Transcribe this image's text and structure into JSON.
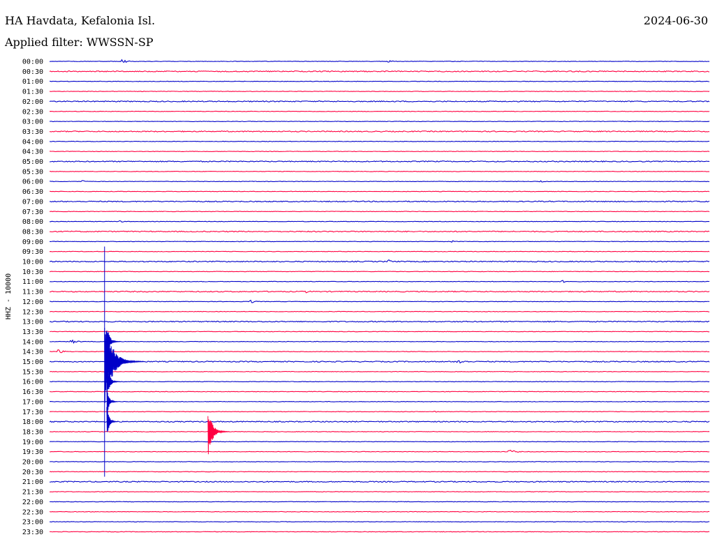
{
  "header": {
    "station": "HA Havdata, Kefalonia Isl.",
    "date": "2024-06-30",
    "filter_label": "Applied filter: WWSSN-SP"
  },
  "colors": {
    "trace_a": "#0000c8",
    "trace_b": "#ff0040",
    "text": "#000000",
    "background": "#ffffff"
  },
  "chart_data": {
    "type": "line",
    "channel_label": "HHZ - 10000",
    "rows": [
      "00:00",
      "00:30",
      "01:00",
      "01:30",
      "02:00",
      "02:30",
      "03:00",
      "03:30",
      "04:00",
      "04:30",
      "05:00",
      "05:30",
      "06:00",
      "06:30",
      "07:00",
      "07:30",
      "08:00",
      "08:30",
      "09:00",
      "09:30",
      "10:00",
      "10:30",
      "11:00",
      "11:30",
      "12:00",
      "12:30",
      "13:00",
      "13:30",
      "14:00",
      "14:30",
      "15:00",
      "15:30",
      "16:00",
      "16:30",
      "17:00",
      "17:30",
      "18:00",
      "18:30",
      "19:00",
      "19:30",
      "20:00",
      "20:30",
      "21:00",
      "21:30",
      "22:00",
      "22:30",
      "23:00",
      "23:30"
    ],
    "row_minutes": 30,
    "series_colors": [
      "trace_a",
      "trace_b"
    ],
    "noise_level": [
      1,
      2,
      1,
      1,
      2,
      1,
      1,
      2,
      1,
      1,
      2,
      1,
      1,
      1,
      2,
      1,
      1,
      2,
      1,
      1,
      2,
      1,
      1,
      2,
      1,
      1,
      2,
      1,
      1,
      1,
      2,
      1,
      1,
      1,
      1,
      1,
      2,
      1,
      1,
      1,
      1,
      1,
      2,
      1,
      1,
      1,
      1,
      1
    ],
    "events": [
      {
        "row": 0,
        "minute": 3.3,
        "amplitude": 3,
        "duration_min": 0.5
      },
      {
        "row": 0,
        "minute": 15.4,
        "amplitude": 2,
        "duration_min": 0.6
      },
      {
        "row": 12,
        "minute": 1.5,
        "amplitude": 2,
        "duration_min": 0.3
      },
      {
        "row": 12,
        "minute": 22.3,
        "amplitude": 2,
        "duration_min": 0.3
      },
      {
        "row": 20,
        "minute": 15.4,
        "amplitude": 3,
        "duration_min": 0.5
      },
      {
        "row": 22,
        "minute": 23.3,
        "amplitude": 2,
        "duration_min": 0.5
      },
      {
        "row": 23,
        "minute": 11.7,
        "amplitude": 2,
        "duration_min": 0.4
      },
      {
        "row": 24,
        "minute": 9.1,
        "amplitude": 3,
        "duration_min": 0.5
      },
      {
        "row": 28,
        "minute": 1.0,
        "amplitude": 3,
        "duration_min": 0.6
      },
      {
        "row": 29,
        "minute": 0.4,
        "amplitude": 4,
        "duration_min": 0.5
      },
      {
        "row": 30,
        "minute": 18.5,
        "amplitude": 6,
        "duration_min": 0.6
      },
      {
        "row": 35,
        "minute": 17.5,
        "amplitude": 2,
        "duration_min": 0.3
      },
      {
        "row": 39,
        "minute": 20.9,
        "amplitude": 3,
        "duration_min": 0.7
      },
      {
        "row": 16,
        "minute": 3.2,
        "amplitude": 2,
        "duration_min": 0.3
      },
      {
        "row": 18,
        "minute": 18.3,
        "amplitude": 2,
        "duration_min": 0.3
      }
    ],
    "major_quake": {
      "row": 30,
      "minute": 2.5,
      "amplitude_rows": 11.5,
      "coda_min": 1.8,
      "secondary_row": 37,
      "secondary_minute": 7.2,
      "secondary_amplitude_rows": 2.6,
      "secondary_coda_min": 1.0
    }
  }
}
